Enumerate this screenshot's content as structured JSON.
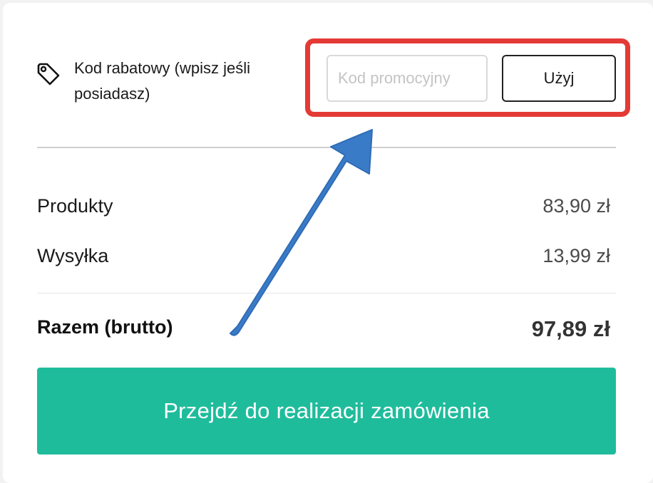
{
  "coupon": {
    "label": "Kod rabatowy (wpisz jeśli posiadasz)",
    "icon": "tag-icon",
    "input_placeholder": "Kod promocyjny",
    "input_value": "",
    "apply_label": "Użyj"
  },
  "summary": {
    "products_label": "Produkty",
    "products_value": "83,90 zł",
    "shipping_label": "Wysyłka",
    "shipping_value": "13,99 zł",
    "total_label": "Razem (brutto)",
    "total_value": "97,89 zł"
  },
  "checkout": {
    "button_label": "Przejdź do realizacji zamówienia"
  },
  "colors": {
    "accent": "#1fbc9c",
    "highlight": "#e43a36",
    "annotation_arrow": "#3a7bc8"
  }
}
